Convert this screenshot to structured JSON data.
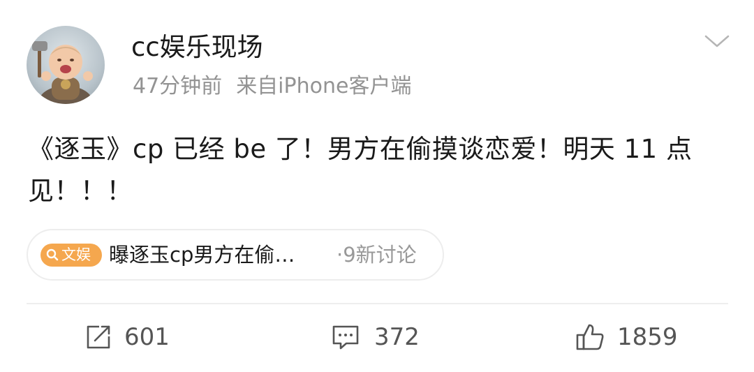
{
  "post": {
    "username": "cc娱乐现场",
    "time": "47分钟前",
    "source": "来自iPhone客户端",
    "text": "《逐玉》cp 已经 be 了！男方在偷摸谈恋爱！明天 11 点见！！！"
  },
  "topic": {
    "badge_label": "文娱",
    "badge_color": "#f5a74e",
    "title": "曝逐玉cp男方在偷…",
    "count": "·9新讨论"
  },
  "actions": {
    "repost_count": "601",
    "comment_count": "372",
    "like_count": "1859"
  },
  "icons": {
    "avatar": "cartoon-baby-viking-avatar",
    "menu": "chevron-down-icon",
    "badge": "search-icon",
    "repost": "share-icon",
    "comment": "comment-icon",
    "like": "thumbs-up-icon"
  }
}
